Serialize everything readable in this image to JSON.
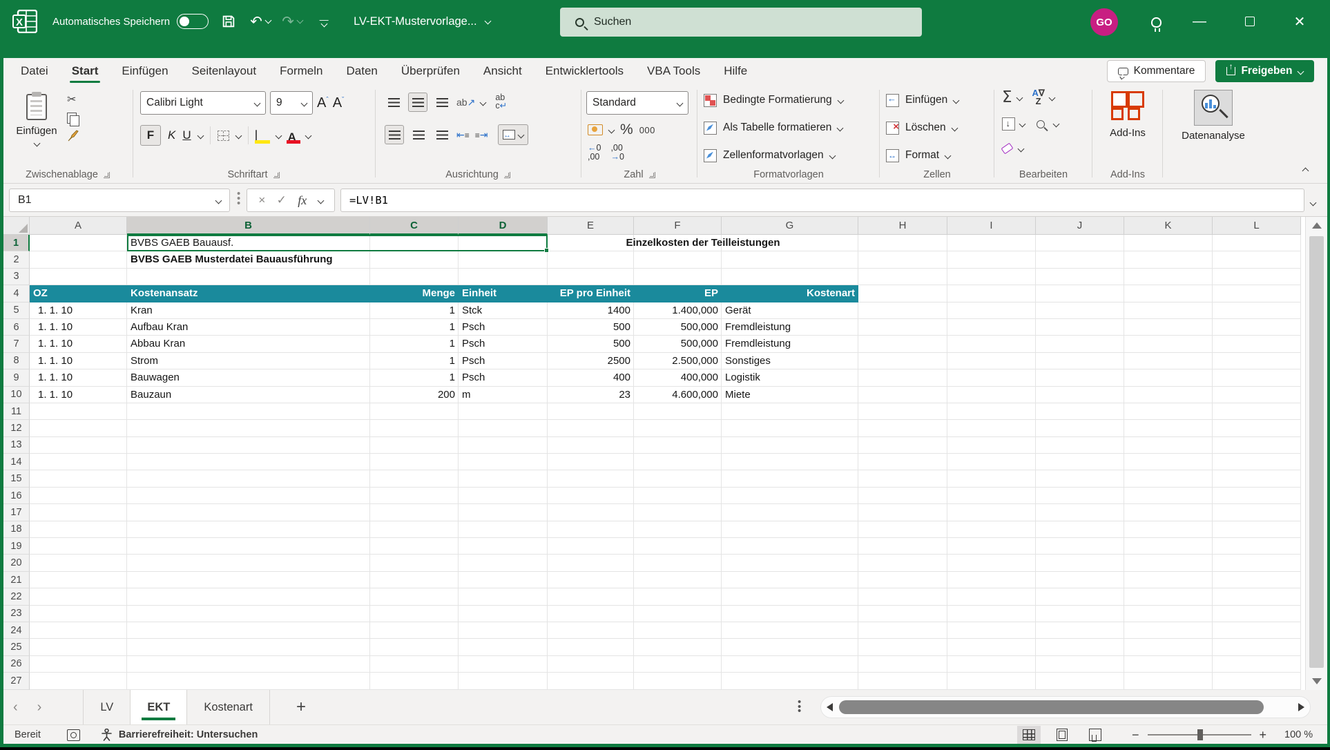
{
  "titlebar": {
    "autosave_label": "Automatisches Speichern",
    "doc_title": "LV-EKT-Mustervorlage...",
    "search_placeholder": "Suchen",
    "avatar_initials": "GO"
  },
  "menubar": {
    "items": [
      "Datei",
      "Start",
      "Einfügen",
      "Seitenlayout",
      "Formeln",
      "Daten",
      "Überprüfen",
      "Ansicht",
      "Entwicklertools",
      "VBA Tools",
      "Hilfe"
    ],
    "active_item": "Start",
    "comments_label": "Kommentare",
    "share_label": "Freigeben"
  },
  "ribbon": {
    "clipboard": {
      "paste_label": "Einfügen",
      "group_label": "Zwischenablage"
    },
    "font": {
      "family": "Calibri Light",
      "size": "9",
      "bold_label": "F",
      "italic_label": "K",
      "underline_label": "U",
      "color_label": "A",
      "group_label": "Schriftart"
    },
    "alignment": {
      "group_label": "Ausrichtung",
      "wrap_label": "ab",
      "wrap_label2": "c"
    },
    "number": {
      "format": "Standard",
      "percent_label": "%",
      "thousands_label": "000",
      "dec_inc_label": "←0 ,00",
      "dec_dec_label": ",00 →0",
      "group_label": "Zahl"
    },
    "styles": {
      "conditional_label": "Bedingte Formatierung",
      "format_table_label": "Als Tabelle formatieren",
      "cell_styles_label": "Zellenformatvorlagen",
      "group_label": "Formatvorlagen"
    },
    "cells": {
      "insert_label": "Einfügen",
      "delete_label": "Löschen",
      "format_label": "Format",
      "group_label": "Zellen"
    },
    "editing": {
      "group_label": "Bearbeiten"
    },
    "addins": {
      "button_label": "Add-Ins",
      "group_label": "Add-Ins"
    },
    "analysis": {
      "button_label": "Datenanalyse"
    }
  },
  "formula_bar": {
    "cell_reference": "B1",
    "formula": "=LV!B1",
    "fx_label": "fx"
  },
  "sheet": {
    "columns": [
      "A",
      "B",
      "C",
      "D",
      "E",
      "F",
      "G",
      "H",
      "I",
      "J",
      "K",
      "L"
    ],
    "selected_columns": [
      "B",
      "C",
      "D"
    ],
    "selected_row": 1,
    "visible_rows": 27,
    "cells": {
      "b1": "BVBS GAEB Bauausf.",
      "e1": "Einzelkosten der Teilleistungen",
      "b2": "BVBS GAEB Musterdatei Bauausführung"
    },
    "table": {
      "header_row": 4,
      "first_data_row": 5,
      "headers": [
        "OZ",
        "Kostenansatz",
        "Menge",
        "Einheit",
        "EP pro Einheit",
        "EP",
        "Kostenart"
      ],
      "rows": [
        [
          "1. 1. 10",
          "Kran",
          "1",
          "Stck",
          "1400",
          "1.400,000",
          "Gerät"
        ],
        [
          "1. 1. 10",
          "Aufbau Kran",
          "1",
          "Psch",
          "500",
          "500,000",
          "Fremdleistung"
        ],
        [
          "1. 1. 10",
          "Abbau Kran",
          "1",
          "Psch",
          "500",
          "500,000",
          "Fremdleistung"
        ],
        [
          "1. 1. 10",
          "Strom",
          "1",
          "Psch",
          "2500",
          "2.500,000",
          "Sonstiges"
        ],
        [
          "1. 1. 10",
          "Bauwagen",
          "1",
          "Psch",
          "400",
          "400,000",
          "Logistik"
        ],
        [
          "1. 1. 10",
          "Bauzaun",
          "200",
          "m",
          "23",
          "4.600,000",
          "Miete"
        ]
      ]
    }
  },
  "sheet_tabs": {
    "tabs": [
      "LV",
      "EKT",
      "Kostenart"
    ],
    "active_tab": "EKT",
    "add_label": "+"
  },
  "status_bar": {
    "mode": "Bereit",
    "accessibility": "Barrierefreiheit: Untersuchen",
    "zoom_level": "100 %"
  },
  "colors": {
    "accent_green": "#0f7b40",
    "avatar_pink": "#c81e82",
    "table_header_teal": "#1a8a9c",
    "selection_border": "#0f7b40"
  }
}
